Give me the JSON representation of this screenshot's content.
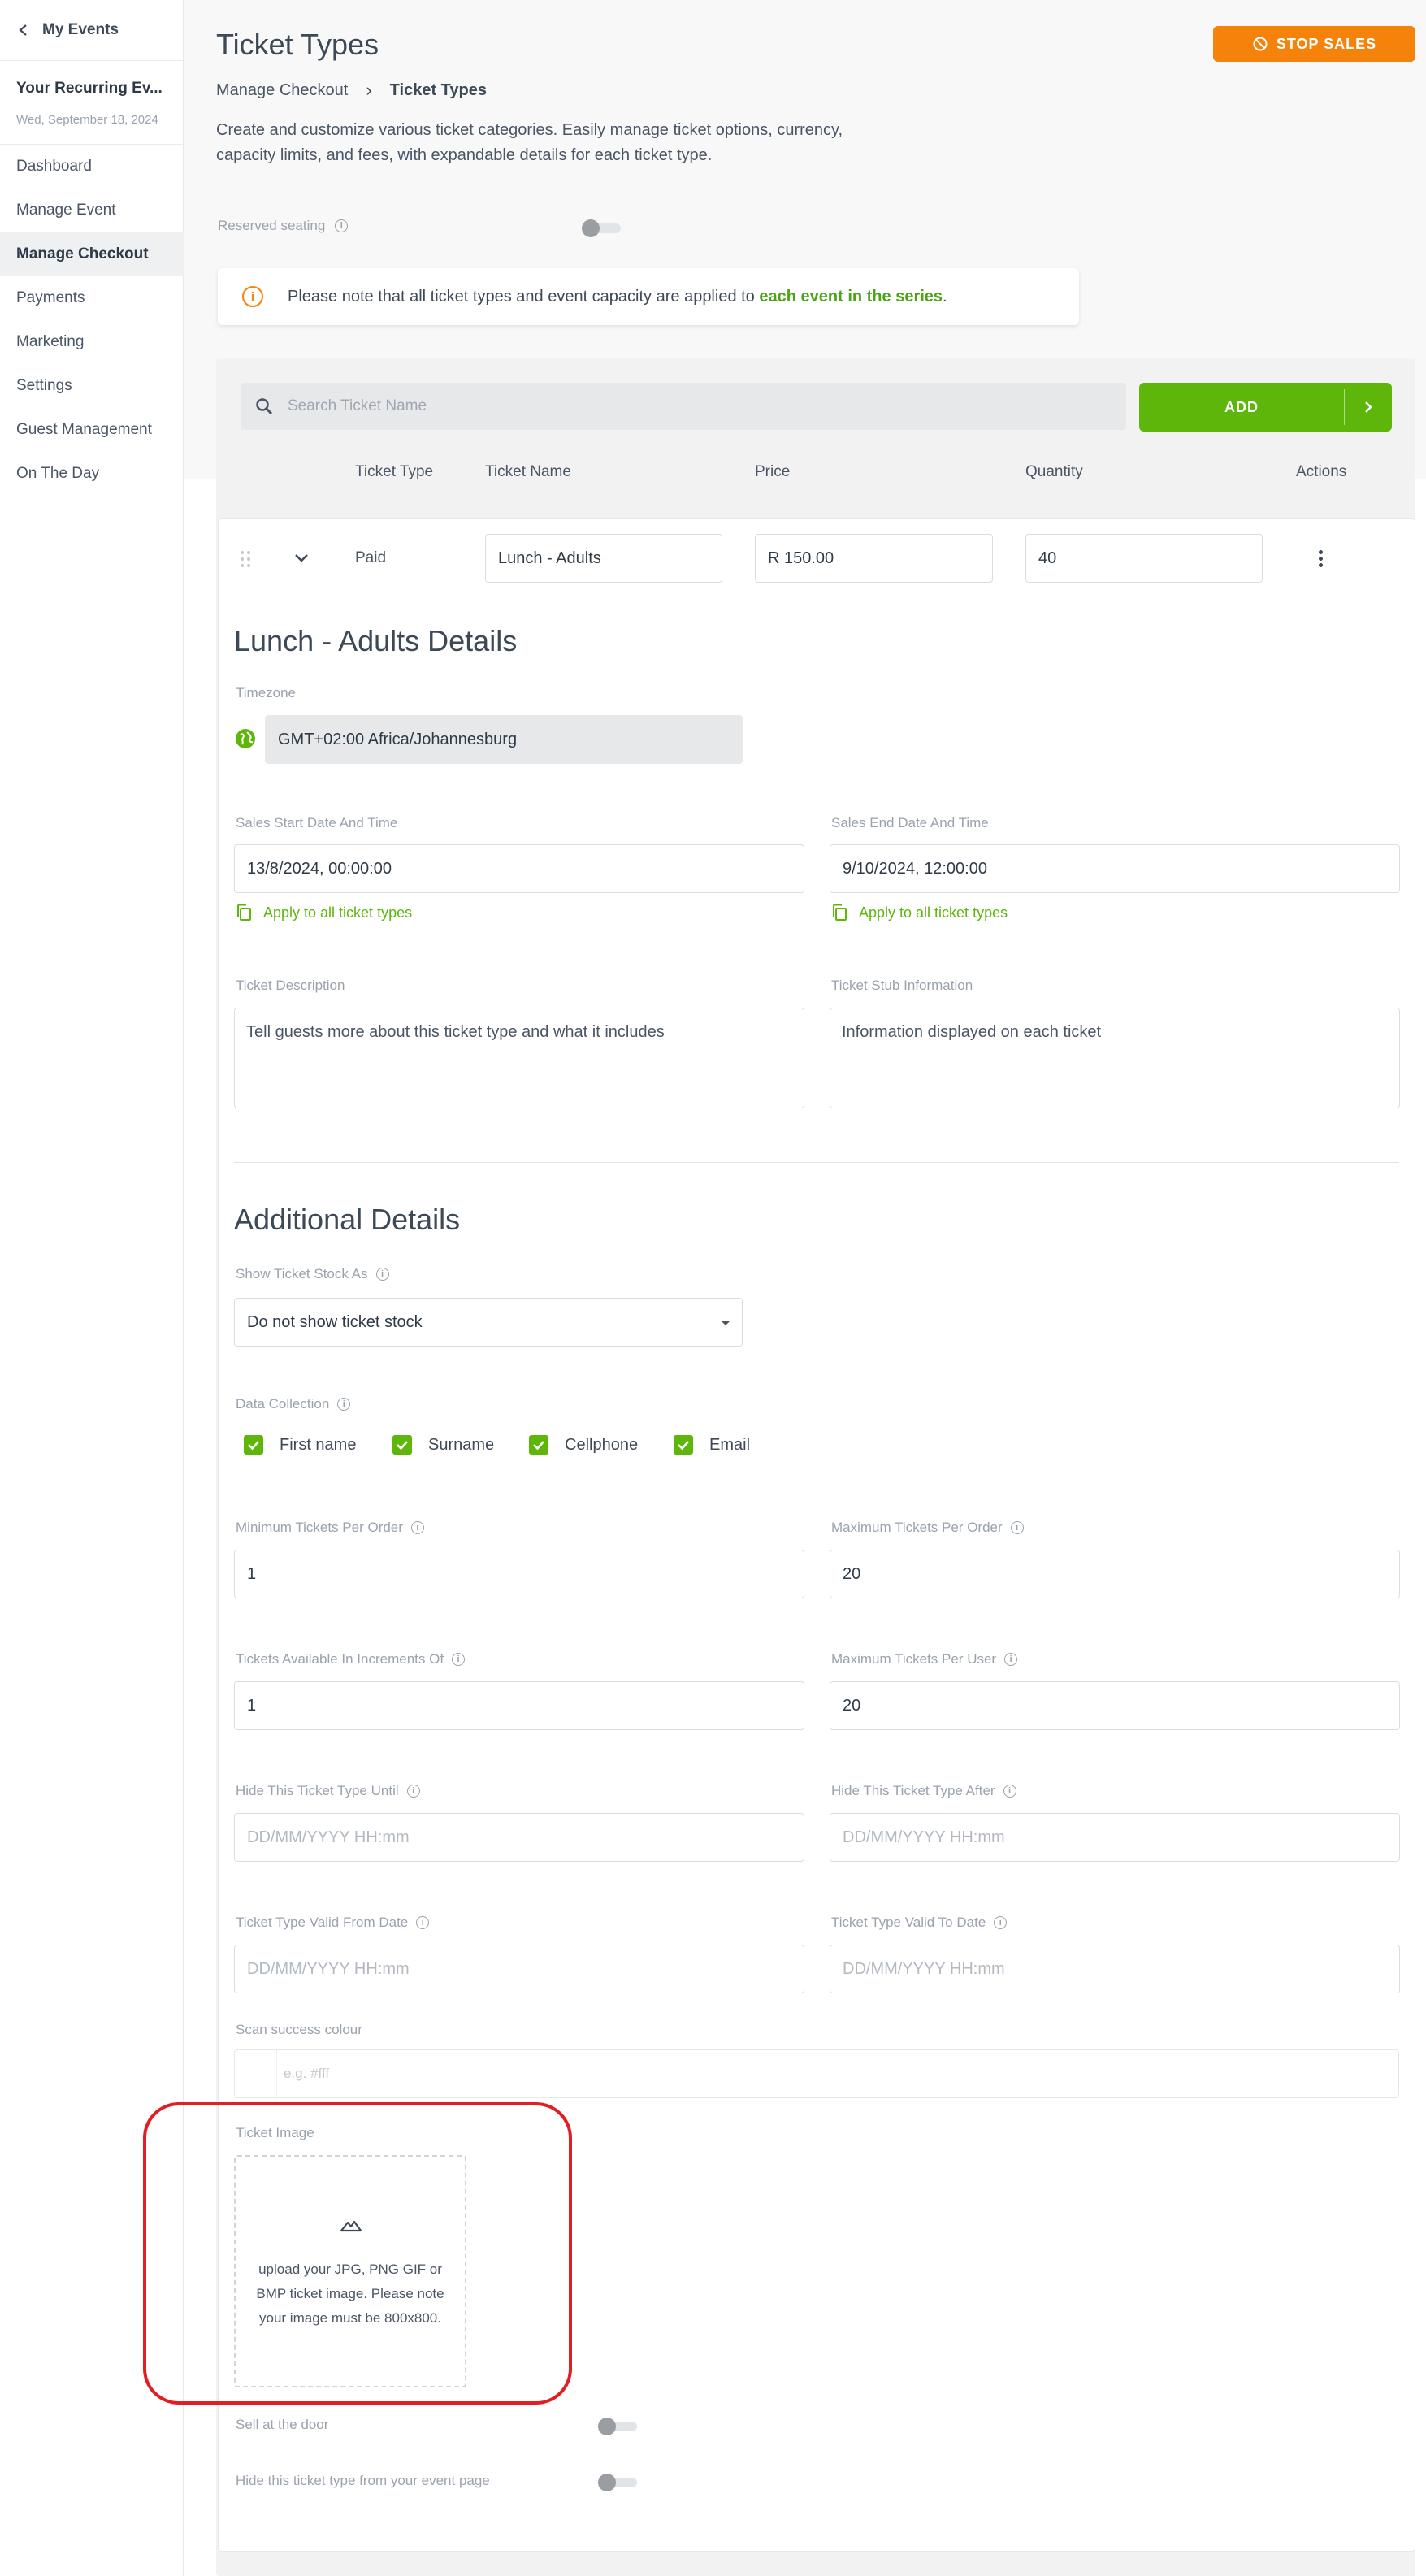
{
  "sidebar": {
    "back_label": "My Events",
    "event_title": "Your Recurring Ev...",
    "event_date": "Wed, September 18, 2024",
    "items": [
      {
        "label": "Dashboard"
      },
      {
        "label": "Manage Event"
      },
      {
        "label": "Manage Checkout"
      },
      {
        "label": "Payments"
      },
      {
        "label": "Marketing"
      },
      {
        "label": "Settings"
      },
      {
        "label": "Guest Management"
      },
      {
        "label": "On The Day"
      }
    ],
    "active_item": "Manage Checkout"
  },
  "header": {
    "title": "Ticket Types",
    "stop_sales_label": "STOP SALES",
    "breadcrumb": {
      "parent": "Manage Checkout",
      "separator": "›",
      "current": "Ticket Types"
    },
    "description": "Create and customize various ticket categories. Easily manage ticket options, currency, capacity limits, and fees, with expandable details for each ticket type."
  },
  "reserved_seating": {
    "label": "Reserved seating",
    "enabled": false
  },
  "notice": {
    "icon": "info-icon",
    "text": "Please note that all ticket types and event capacity are applied to ",
    "emphasis": "each event in the series",
    "suffix": "."
  },
  "toolbar": {
    "search_placeholder": "Search Ticket Name",
    "add_label": "ADD"
  },
  "table": {
    "columns": [
      "Ticket Type",
      "Ticket Name",
      "Price",
      "Quantity",
      "Actions"
    ],
    "row": {
      "ticket_type": "Paid",
      "ticket_name": "Lunch - Adults",
      "price": "R 150.00",
      "quantity": "40"
    }
  },
  "details": {
    "title": "Lunch - Adults Details",
    "timezone_label": "Timezone",
    "timezone_value": "GMT+02:00 Africa/Johannesburg",
    "sales_start_label": "Sales Start Date And Time",
    "sales_start_value": "13/8/2024, 00:00:00",
    "sales_end_label": "Sales End Date And Time",
    "sales_end_value": "9/10/2024, 12:00:00",
    "apply_all_label": "Apply to all ticket types",
    "description_label": "Ticket Description",
    "description_placeholder": "Tell guests more about this ticket type and what it includes",
    "stub_label": "Ticket Stub Information",
    "stub_placeholder": "Information displayed on each ticket"
  },
  "additional": {
    "title": "Additional Details",
    "stock_label": "Show Ticket Stock As",
    "stock_value": "Do not show ticket stock",
    "data_collection_label": "Data Collection",
    "data_collection": [
      {
        "label": "First name",
        "checked": true
      },
      {
        "label": "Surname",
        "checked": true
      },
      {
        "label": "Cellphone",
        "checked": true
      },
      {
        "label": "Email",
        "checked": true
      }
    ],
    "min_per_order_label": "Minimum Tickets Per Order",
    "min_per_order": "1",
    "max_per_order_label": "Maximum Tickets Per Order",
    "max_per_order": "20",
    "increments_label": "Tickets Available In Increments Of",
    "increments": "1",
    "max_per_user_label": "Maximum Tickets Per User",
    "max_per_user": "20",
    "hide_until_label": "Hide This Ticket Type Until",
    "hide_after_label": "Hide This Ticket Type After",
    "date_placeholder": "DD/MM/YYYY HH:mm",
    "valid_from_label": "Ticket Type Valid From Date",
    "valid_to_label": "Ticket Type Valid To Date",
    "scan_colour_label": "Scan success colour",
    "scan_colour_placeholder": "e.g. #fff",
    "ticket_image_label": "Ticket Image",
    "upload_text": "upload your JPG, PNG GIF or BMP ticket image. Please note your image must be 800x800.",
    "sell_at_door_label": "Sell at the door",
    "sell_at_door": false,
    "hide_from_page_label": "Hide this ticket type from your event page",
    "hide_from_page": false
  },
  "colors": {
    "accent_green": "#5eb60b",
    "accent_orange": "#f5820b",
    "highlight_red": "#e01e24"
  }
}
